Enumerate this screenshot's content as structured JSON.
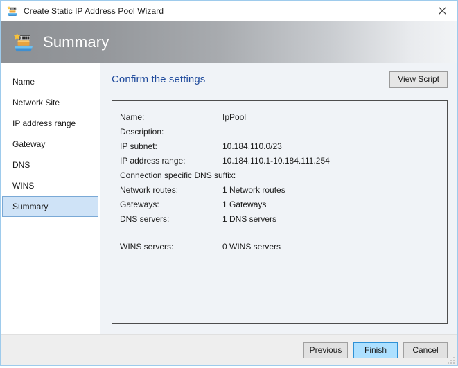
{
  "window": {
    "title": "Create Static IP Address Pool Wizard",
    "close_label": "✕",
    "icon": "ip-address-pool-icon"
  },
  "banner": {
    "title": "Summary",
    "icon": "ip-address-pool-icon"
  },
  "sidebar": {
    "items": [
      {
        "label": "Name",
        "selected": false
      },
      {
        "label": "Network Site",
        "selected": false
      },
      {
        "label": "IP address range",
        "selected": false
      },
      {
        "label": "Gateway",
        "selected": false
      },
      {
        "label": "DNS",
        "selected": false
      },
      {
        "label": "WINS",
        "selected": false
      },
      {
        "label": "Summary",
        "selected": true
      }
    ]
  },
  "content": {
    "title": "Confirm the settings",
    "view_script_label": "View Script",
    "summary_rows": [
      {
        "label": "Name:",
        "value": "IpPool",
        "gap_before": false
      },
      {
        "label": "Description:",
        "value": "",
        "gap_before": false
      },
      {
        "label": "IP subnet:",
        "value": "10.184.110.0/23",
        "gap_before": false
      },
      {
        "label": "IP address range:",
        "value": "10.184.110.1-10.184.111.254",
        "gap_before": false
      },
      {
        "label": "Connection specific DNS suffix:",
        "value": "",
        "gap_before": false
      },
      {
        "label": "Network routes:",
        "value": "1 Network routes",
        "gap_before": false
      },
      {
        "label": "Gateways:",
        "value": "1 Gateways",
        "gap_before": false
      },
      {
        "label": "DNS servers:",
        "value": "1 DNS servers",
        "gap_before": false
      },
      {
        "label": "WINS servers:",
        "value": "0 WINS servers",
        "gap_before": true
      }
    ]
  },
  "footer": {
    "buttons": [
      {
        "label": "Previous",
        "default": false
      },
      {
        "label": "Finish",
        "default": true
      },
      {
        "label": "Cancel",
        "default": false
      }
    ]
  },
  "colors": {
    "accent_blue": "#1f4a9c",
    "selection_blue": "#cfe3f7",
    "selection_border": "#7aa9d6",
    "default_button_fill": "#ade0ff",
    "default_button_border": "#2e91d6",
    "content_background": "#f0f3f7",
    "window_border": "#9ecbec",
    "footer_background": "#eeeeee"
  }
}
